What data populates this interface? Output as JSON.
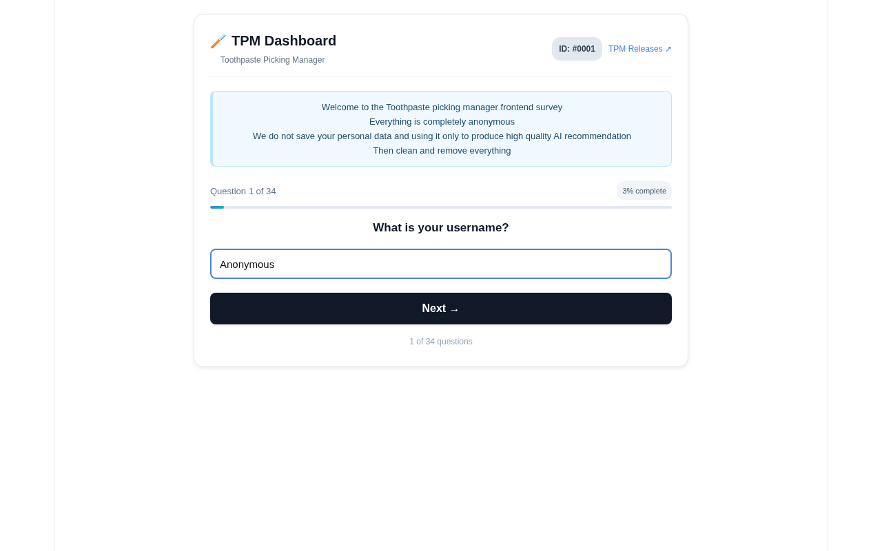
{
  "header": {
    "title": "TPM Dashboard",
    "subtitle": "Toothpaste Picking Manager",
    "id_badge": "ID: #0001",
    "link": "TPM Releases ↗"
  },
  "notice": {
    "lines": [
      "Welcome to the Toothpaste picking manager frontend survey",
      "Everything is completely anonymous",
      "We do not save your personal data and using it only to produce high quality AI recommendation",
      "Then clean and remove everything"
    ]
  },
  "progress": {
    "question_label": "Question 1 of 34",
    "percent_label": "3% complete",
    "level": 0.03
  },
  "question": {
    "title": "What is your username?",
    "input": {
      "value": "Anonymous",
      "focused": true
    }
  },
  "next_button": {
    "label": "Next →"
  },
  "footer": "1 of 34 questions"
}
